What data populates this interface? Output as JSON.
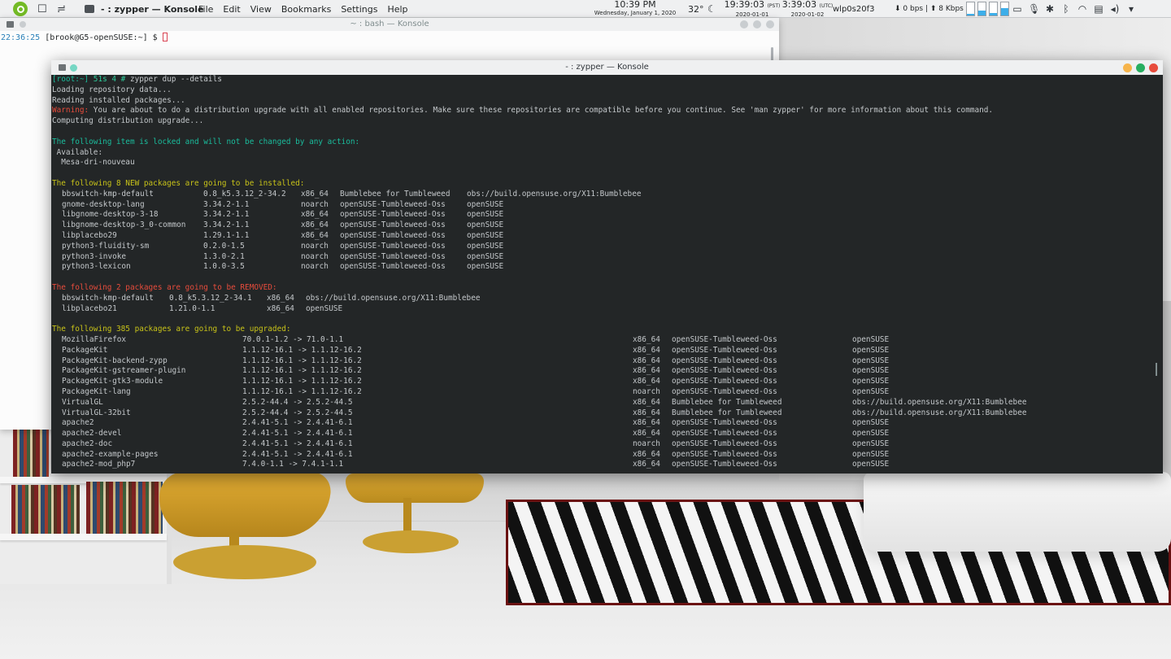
{
  "panel": {
    "app_title": "- : zypper — Konsole",
    "menu": [
      "File",
      "Edit",
      "View",
      "Bookmarks",
      "Settings",
      "Help"
    ],
    "clock_local_time": "10:39 PM",
    "clock_local_date": "Wednesday, January 1, 2020",
    "temperature": "32°",
    "clock_pst_time": "19:39:03",
    "clock_pst_tz": "(PST)",
    "clock_pst_date": "2020-01-01",
    "clock_utc_time": "3:39:03",
    "clock_utc_tz": "(UTC)",
    "clock_utc_date": "2020-01-02",
    "network_interface": "wlp0s20f3",
    "net_speed": "⬇ 0 bps | ⬆ 8 Kbps",
    "graph_levels": [
      0.1,
      0.35,
      0.2,
      0.55
    ],
    "tray_icons": [
      "battery-icon",
      "microphone-icon",
      "settings-icon",
      "bluetooth-icon",
      "wifi-icon",
      "clipboard-icon",
      "volume-icon",
      "expand-icon"
    ]
  },
  "bash_window": {
    "title": "~ : bash — Konsole",
    "prompt_time": "22:36:25",
    "prompt_text": " [brook@G5-openSUSE:~] $ "
  },
  "zypper_window": {
    "title": "- : zypper — Konsole",
    "prompt_user": "[root:~]",
    "prompt_info": " 51s 4 # ",
    "command": "zypper dup --details",
    "loading_repo": "Loading repository data...",
    "reading_installed": "Reading installed packages...",
    "warning_label": "Warning:",
    "warning_text": " You are about to do a distribution upgrade with all enabled repositories. Make sure these repositories are compatible before you continue. See 'man zypper' for more information about this command.",
    "computing": "Computing distribution upgrade...",
    "locked_header": "The following item is locked and will not be changed by any action:",
    "locked_available": " Available:",
    "locked_item": "  Mesa-dri-nouveau",
    "new_header": "The following 8 NEW packages are going to be installed:",
    "new_packages": [
      {
        "name": "bbswitch-kmp-default",
        "version": "0.8_k5.3.12_2-34.2",
        "arch": "x86_64",
        "repo": "Bumblebee for Tumbleweed",
        "vendor": "obs://build.opensuse.org/X11:Bumblebee"
      },
      {
        "name": "gnome-desktop-lang",
        "version": "3.34.2-1.1",
        "arch": "noarch",
        "repo": "openSUSE-Tumbleweed-Oss",
        "vendor": "openSUSE"
      },
      {
        "name": "libgnome-desktop-3-18",
        "version": "3.34.2-1.1",
        "arch": "x86_64",
        "repo": "openSUSE-Tumbleweed-Oss",
        "vendor": "openSUSE"
      },
      {
        "name": "libgnome-desktop-3_0-common",
        "version": "3.34.2-1.1",
        "arch": "x86_64",
        "repo": "openSUSE-Tumbleweed-Oss",
        "vendor": "openSUSE"
      },
      {
        "name": "libplacebo29",
        "version": "1.29.1-1.1",
        "arch": "x86_64",
        "repo": "openSUSE-Tumbleweed-Oss",
        "vendor": "openSUSE"
      },
      {
        "name": "python3-fluidity-sm",
        "version": "0.2.0-1.5",
        "arch": "noarch",
        "repo": "openSUSE-Tumbleweed-Oss",
        "vendor": "openSUSE"
      },
      {
        "name": "python3-invoke",
        "version": "1.3.0-2.1",
        "arch": "noarch",
        "repo": "openSUSE-Tumbleweed-Oss",
        "vendor": "openSUSE"
      },
      {
        "name": "python3-lexicon",
        "version": "1.0.0-3.5",
        "arch": "noarch",
        "repo": "openSUSE-Tumbleweed-Oss",
        "vendor": "openSUSE"
      }
    ],
    "removed_header": "The following 2 packages are going to be REMOVED:",
    "removed_packages": [
      {
        "name": "bbswitch-kmp-default",
        "version": "0.8_k5.3.12_2-34.1",
        "arch": "x86_64",
        "vendor": "obs://build.opensuse.org/X11:Bumblebee"
      },
      {
        "name": "libplacebo21",
        "version": "1.21.0-1.1",
        "arch": "x86_64",
        "vendor": "openSUSE"
      }
    ],
    "upgrade_header": "The following 385 packages are going to be upgraded:",
    "upgrade_packages": [
      {
        "name": "MozillaFirefox",
        "version": "70.0.1-1.2 -> 71.0-1.1",
        "arch": "x86_64",
        "repo": "openSUSE-Tumbleweed-Oss",
        "vendor": "openSUSE"
      },
      {
        "name": "PackageKit",
        "version": "1.1.12-16.1 -> 1.1.12-16.2",
        "arch": "x86_64",
        "repo": "openSUSE-Tumbleweed-Oss",
        "vendor": "openSUSE"
      },
      {
        "name": "PackageKit-backend-zypp",
        "version": "1.1.12-16.1 -> 1.1.12-16.2",
        "arch": "x86_64",
        "repo": "openSUSE-Tumbleweed-Oss",
        "vendor": "openSUSE"
      },
      {
        "name": "PackageKit-gstreamer-plugin",
        "version": "1.1.12-16.1 -> 1.1.12-16.2",
        "arch": "x86_64",
        "repo": "openSUSE-Tumbleweed-Oss",
        "vendor": "openSUSE"
      },
      {
        "name": "PackageKit-gtk3-module",
        "version": "1.1.12-16.1 -> 1.1.12-16.2",
        "arch": "x86_64",
        "repo": "openSUSE-Tumbleweed-Oss",
        "vendor": "openSUSE"
      },
      {
        "name": "PackageKit-lang",
        "version": "1.1.12-16.1 -> 1.1.12-16.2",
        "arch": "noarch",
        "repo": "openSUSE-Tumbleweed-Oss",
        "vendor": "openSUSE"
      },
      {
        "name": "VirtualGL",
        "version": "2.5.2-44.4 -> 2.5.2-44.5",
        "arch": "x86_64",
        "repo": "Bumblebee for Tumbleweed",
        "vendor": "obs://build.opensuse.org/X11:Bumblebee"
      },
      {
        "name": "VirtualGL-32bit",
        "version": "2.5.2-44.4 -> 2.5.2-44.5",
        "arch": "x86_64",
        "repo": "Bumblebee for Tumbleweed",
        "vendor": "obs://build.opensuse.org/X11:Bumblebee"
      },
      {
        "name": "apache2",
        "version": "2.4.41-5.1 -> 2.4.41-6.1",
        "arch": "x86_64",
        "repo": "openSUSE-Tumbleweed-Oss",
        "vendor": "openSUSE"
      },
      {
        "name": "apache2-devel",
        "version": "2.4.41-5.1 -> 2.4.41-6.1",
        "arch": "x86_64",
        "repo": "openSUSE-Tumbleweed-Oss",
        "vendor": "openSUSE"
      },
      {
        "name": "apache2-doc",
        "version": "2.4.41-5.1 -> 2.4.41-6.1",
        "arch": "noarch",
        "repo": "openSUSE-Tumbleweed-Oss",
        "vendor": "openSUSE"
      },
      {
        "name": "apache2-example-pages",
        "version": "2.4.41-5.1 -> 2.4.41-6.1",
        "arch": "x86_64",
        "repo": "openSUSE-Tumbleweed-Oss",
        "vendor": "openSUSE"
      },
      {
        "name": "apache2-mod_php7",
        "version": "7.4.0-1.1 -> 7.4.1-1.1",
        "arch": "x86_64",
        "repo": "openSUSE-Tumbleweed-Oss",
        "vendor": "openSUSE"
      }
    ]
  }
}
